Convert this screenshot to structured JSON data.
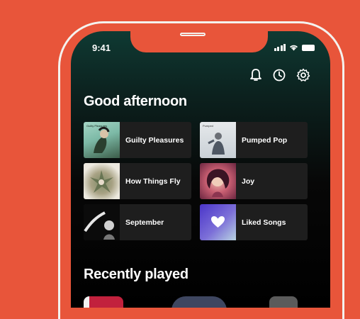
{
  "status": {
    "time": "9:41"
  },
  "header_icons": [
    "bell-icon",
    "history-icon",
    "settings-gear-icon"
  ],
  "greeting": "Good afternoon",
  "shortcuts": [
    {
      "label": "Guilty Pleasures",
      "cover_title": "Guilty Pleasures",
      "colors": [
        "#8fc9b8",
        "#2f4a38",
        "#e6d7c2"
      ]
    },
    {
      "label": "Pumped Pop",
      "cover_title": "Pumped",
      "colors": [
        "#d9dde0",
        "#6f7a86",
        "#a8b4c0"
      ]
    },
    {
      "label": "How Things Fly",
      "cover_title": "",
      "colors": [
        "#eae6da",
        "#6f7e5d",
        "#a79a7c"
      ]
    },
    {
      "label": "Joy",
      "cover_title": "",
      "colors": [
        "#7c2f4a",
        "#e4b5a8",
        "#c25d6f"
      ]
    },
    {
      "label": "September",
      "cover_title": "",
      "colors": [
        "#0d0d0d",
        "#d8d8d8",
        "#4a4a4a"
      ]
    },
    {
      "label": "Liked Songs",
      "cover_title": "",
      "colors": [
        "#4b39c7",
        "#b6d3e1",
        "#ffffff"
      ]
    }
  ],
  "recently_played_title": "Recently played",
  "colors": {
    "background": "#e8553a",
    "screen_top": "#0f3a33",
    "tile": "#1e1e1e",
    "text": "#ffffff"
  }
}
